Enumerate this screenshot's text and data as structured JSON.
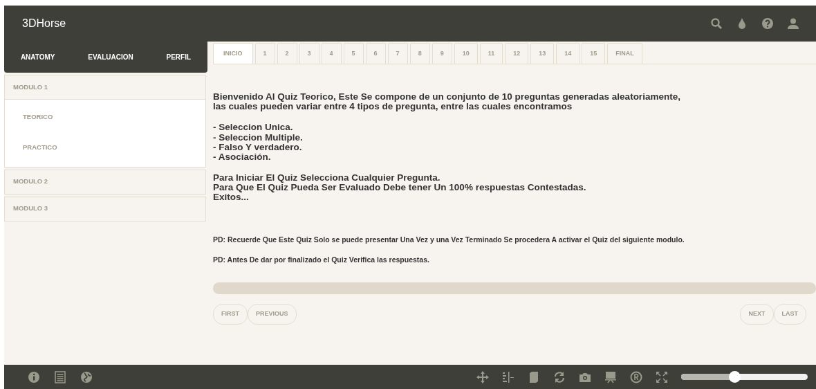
{
  "header": {
    "title": "3DHorse"
  },
  "nav": [
    {
      "label": "ANATOMY"
    },
    {
      "label": "EVALUACION"
    },
    {
      "label": "PERFIL"
    }
  ],
  "modules": [
    {
      "label": "MODULO 1",
      "expanded": true,
      "items": [
        "TEORICO",
        "PRACTICO"
      ]
    },
    {
      "label": "MODULO 2",
      "expanded": false
    },
    {
      "label": "MODULO 3",
      "expanded": false
    }
  ],
  "tabs": [
    {
      "label": "INICIO",
      "selected": true
    },
    {
      "label": "1",
      "selected": false
    },
    {
      "label": "2",
      "selected": false
    },
    {
      "label": "3",
      "selected": false
    },
    {
      "label": "4",
      "selected": false
    },
    {
      "label": "5",
      "selected": false
    },
    {
      "label": "6",
      "selected": false
    },
    {
      "label": "7",
      "selected": false
    },
    {
      "label": "8",
      "selected": false
    },
    {
      "label": "9",
      "selected": false
    },
    {
      "label": "10",
      "selected": false
    },
    {
      "label": "11",
      "selected": false
    },
    {
      "label": "12",
      "selected": false
    },
    {
      "label": "13",
      "selected": false
    },
    {
      "label": "14",
      "selected": false
    },
    {
      "label": "15",
      "selected": false
    },
    {
      "label": "FINAL",
      "selected": false
    }
  ],
  "intro": [
    [
      "Bienvenido Al Quiz Teorico, Este Se compone de un conjunto de 10 preguntas generadas aleatoriamente,",
      "las cuales pueden variar entre 4 tipos de pregunta, entre las cuales encontramos"
    ],
    [
      "- Seleccion Unica.",
      "- Seleccion Multiple.",
      "- Falso Y verdadero.",
      "- Asociación."
    ],
    [
      "Para Iniciar El Quiz Selecciona Cualquier Pregunta.",
      "Para Que El Quiz Pueda Ser Evaluado Debe tener Un 100% respuestas Contestadas.",
      "Exitos..."
    ]
  ],
  "notes": [
    "PD: Recuerde Que Este Quiz Solo se puede presentar Una Vez y una Vez Terminado Se procedera A activar el Quiz del siguiente modulo.",
    "PD: Antes De dar por finalizado el Quiz Verifica las respuestas."
  ],
  "progress": {
    "level": 0
  },
  "pager_left": [
    "FIRST",
    "PREVIOUS"
  ],
  "pager_right": [
    "NEXT",
    "LAST"
  ],
  "footer": {
    "zoom": {
      "level": 0.42
    }
  }
}
